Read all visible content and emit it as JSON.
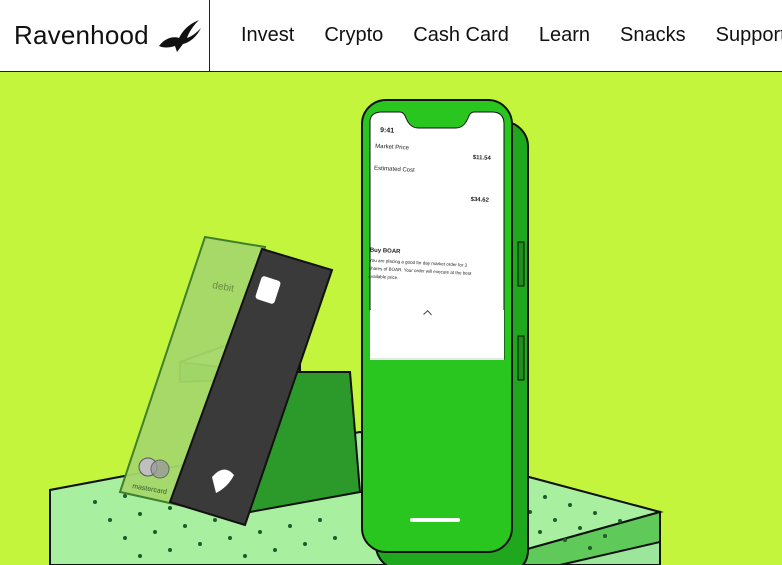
{
  "header": {
    "brand": "Ravenhood",
    "brand_icon": "bird-icon",
    "nav": [
      {
        "label": "Invest"
      },
      {
        "label": "Crypto"
      },
      {
        "label": "Cash Card"
      },
      {
        "label": "Learn"
      },
      {
        "label": "Snacks"
      },
      {
        "label": "Support"
      }
    ]
  },
  "hero": {
    "background_color": "#c3f53c",
    "phone": {
      "time": "9:41",
      "market_price_label": "Market Price",
      "market_price_value": "$11.54",
      "estimated_cost_label": "Estimated Cost",
      "estimated_cost_value": "$34.62",
      "order_title": "Buy BOAR",
      "order_text_1": "You are placing a good for day market order for 3",
      "order_text_2": "shares of BOAR. Your order will execute at the best",
      "order_text_3": "available price."
    },
    "card": {
      "type_label": "debit",
      "network_label": "mastercard"
    }
  }
}
